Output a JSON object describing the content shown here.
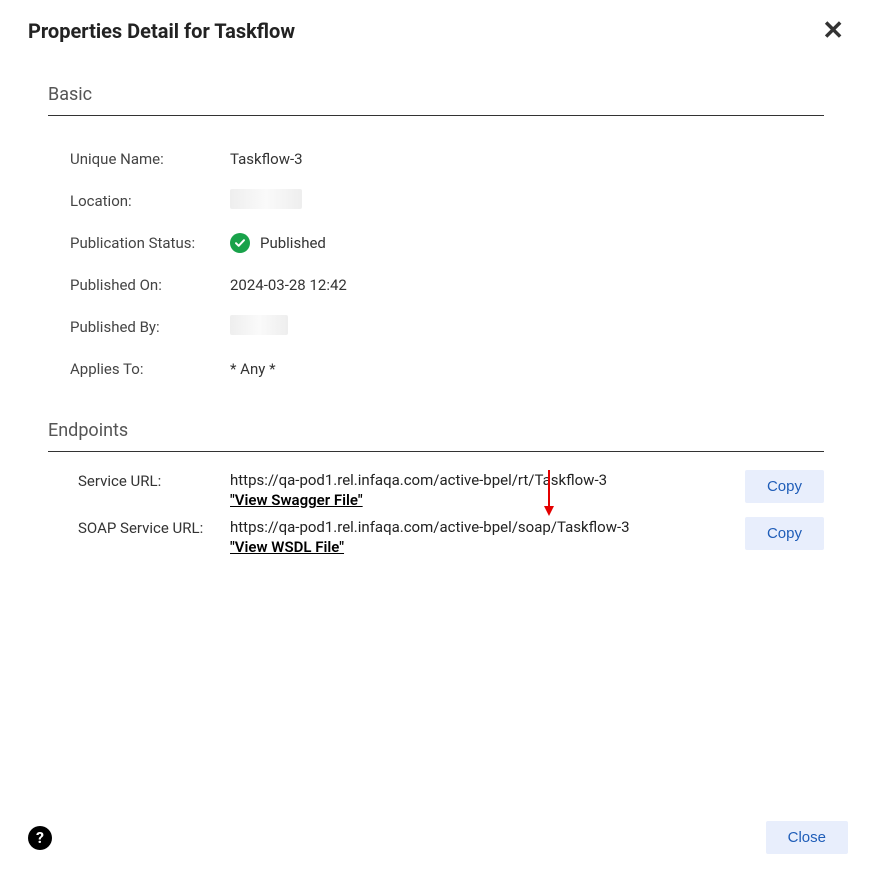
{
  "dialog": {
    "title": "Properties Detail for Taskflow",
    "close_x": "✕"
  },
  "basic": {
    "heading": "Basic",
    "rows": {
      "unique_name_label": "Unique Name:",
      "unique_name_value": "Taskflow-3",
      "location_label": "Location:",
      "pub_status_label": "Publication Status:",
      "pub_status_value": "Published",
      "pub_on_label": "Published On:",
      "pub_on_value": "2024-03-28 12:42",
      "pub_by_label": "Published By:",
      "applies_to_label": "Applies To:",
      "applies_to_value": "* Any *"
    }
  },
  "endpoints": {
    "heading": "Endpoints",
    "service_url_label": "Service URL:",
    "service_url_value": "https://qa-pod1.rel.infaqa.com/active-bpel/rt/Taskflow-3",
    "service_url_link": "\"View Swagger File\"",
    "soap_url_label": "SOAP Service URL:",
    "soap_url_value": "https://qa-pod1.rel.infaqa.com/active-bpel/soap/Taskflow-3",
    "soap_url_link": "\"View WSDL File\"",
    "copy_label": "Copy"
  },
  "footer": {
    "help": "?",
    "close_label": "Close"
  },
  "status_colors": {
    "published": "#19a24a",
    "accent": "#1f5db8"
  }
}
